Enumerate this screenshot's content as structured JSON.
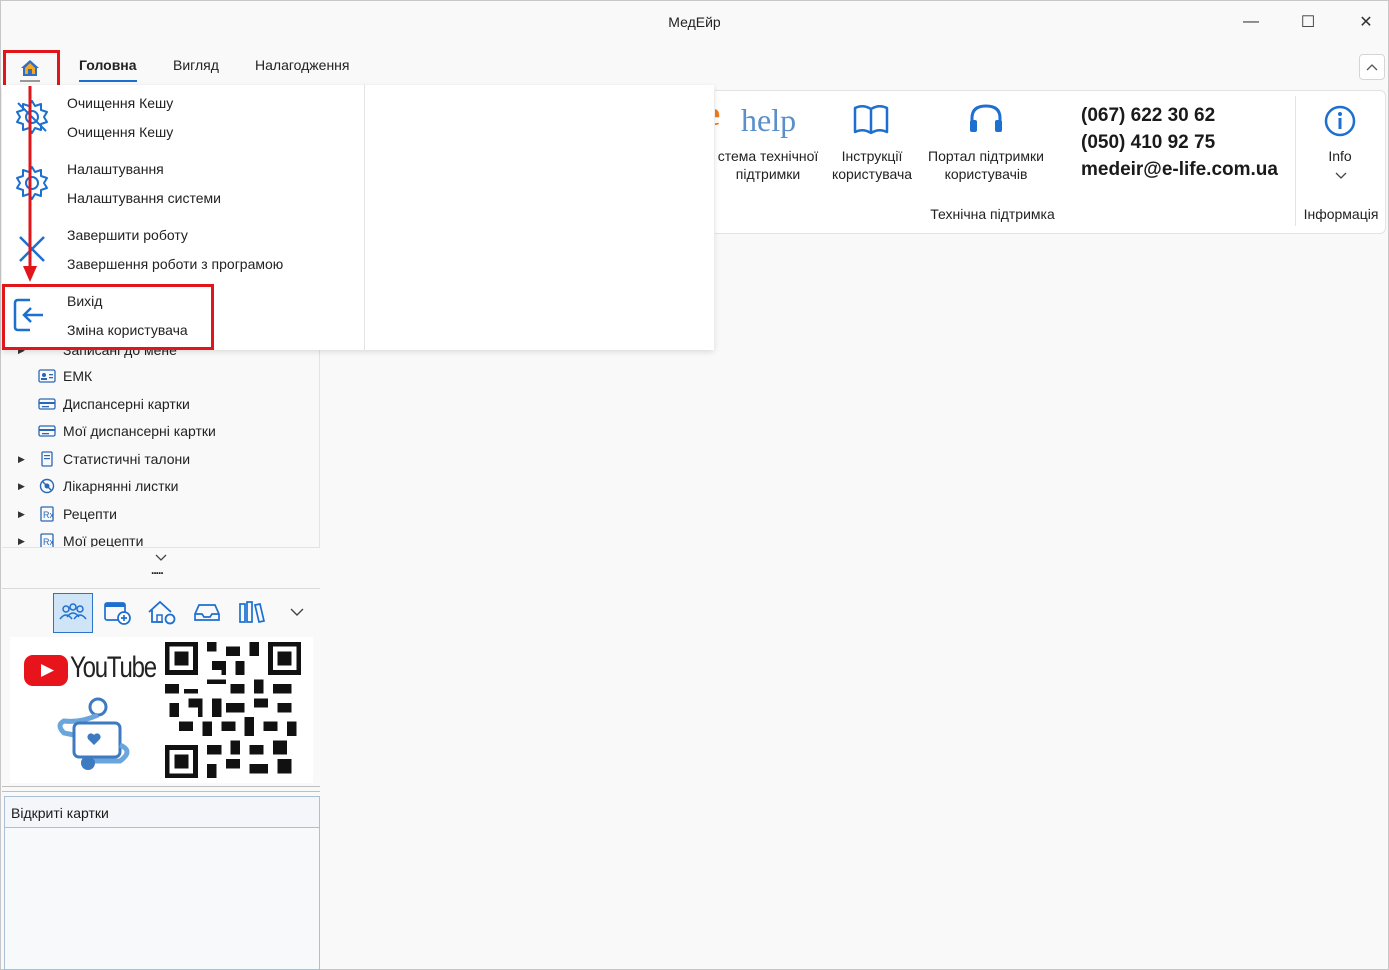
{
  "window": {
    "title": "МедЕйр",
    "controls": {
      "minimize": "—",
      "maximize": "☐",
      "close": "✕"
    }
  },
  "ribbon_tabs": [
    {
      "label": "Головна",
      "active": true
    },
    {
      "label": "Вигляд",
      "active": false
    },
    {
      "label": "Налагодження",
      "active": false
    }
  ],
  "app_menu": {
    "items": [
      {
        "title": "Очищення Кешу",
        "subtitle": "Очищення Кешу",
        "icon": "gear-off-icon"
      },
      {
        "title": "Налаштування",
        "subtitle": "Налаштування системи",
        "icon": "gear-icon"
      },
      {
        "title": "Завершити роботу",
        "subtitle": "Завершення роботи з програмою",
        "icon": "close-x-icon"
      },
      {
        "title": "Вихід",
        "subtitle": "Зміна користувача",
        "icon": "logout-icon",
        "highlighted": true
      }
    ]
  },
  "ribbon": {
    "ehelp": {
      "logo_e": "e",
      "logo_help": "help",
      "label": "стема технічної\nпідтримки"
    },
    "manuals": {
      "label": "Інструкції\nкористувача"
    },
    "portal": {
      "label": "Портал підтримки\nкористувачів"
    },
    "contacts": {
      "phone1": "(067) 622 30 62",
      "phone2": "(050) 410 92 75",
      "email": "medeir@e-life.com.ua"
    },
    "group_support": "Технічна підтримка",
    "info": {
      "label": "Info",
      "group": "Інформація"
    }
  },
  "tree": {
    "partial_top": "Записані до мене",
    "items": [
      {
        "label": "ЕМК",
        "expander": false,
        "icon": "id-card-icon"
      },
      {
        "label": "Диспансерні картки",
        "expander": false,
        "icon": "card-icon"
      },
      {
        "label": "Мої диспансерні картки",
        "expander": false,
        "icon": "card-icon"
      },
      {
        "label": "Статистичні талони",
        "expander": true,
        "icon": "document-icon"
      },
      {
        "label": "Лікарнянні листки",
        "expander": true,
        "icon": "sick-leave-icon"
      },
      {
        "label": "Рецепти",
        "expander": true,
        "icon": "prescription-icon"
      },
      {
        "label": "Мої рецепти",
        "expander": true,
        "icon": "prescription-icon"
      }
    ],
    "more_dots": "....."
  },
  "toolbar_icons": [
    "patients-icon",
    "calendar-add-icon",
    "home-settings-icon",
    "inbox-icon",
    "library-icon",
    "chevron-down-icon"
  ],
  "promo": {
    "youtube_text": "YouTube"
  },
  "open_cards": {
    "header": "Відкриті картки"
  },
  "colors": {
    "accent": "#1c6fd1",
    "highlight_red": "#e0161b",
    "ehelp_orange": "#f07a1a",
    "ehelp_blue": "#5a8fc9"
  }
}
